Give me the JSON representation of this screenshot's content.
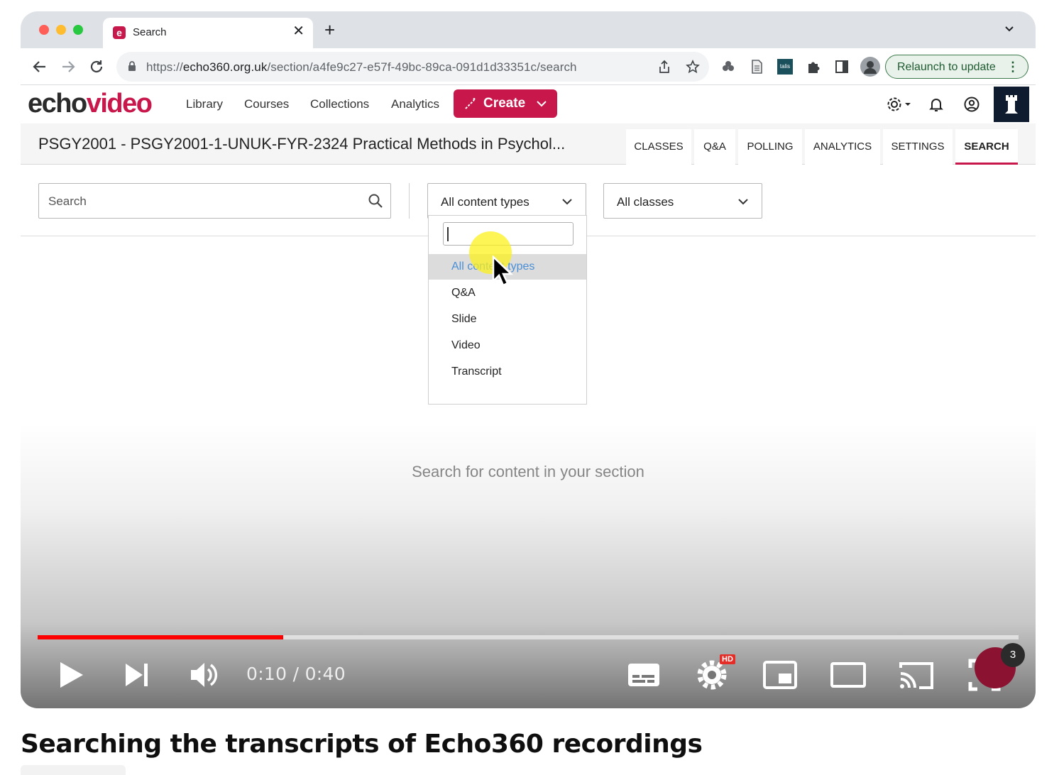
{
  "browser": {
    "tab_title": "Search",
    "url_scheme": "https://",
    "url_host": "echo360.org.uk",
    "url_path": "/section/a4fe9c27-e57f-49bc-89ca-091d1d33351c/search",
    "relaunch_label": "Relaunch to update",
    "ext_label": "talis"
  },
  "app": {
    "logo_echo": "echo",
    "logo_video": "video",
    "nav": [
      "Library",
      "Courses",
      "Collections",
      "Analytics"
    ],
    "create_label": "Create"
  },
  "course": {
    "title": "PSGY2001 - PSGY2001-1-UNUK-FYR-2324 Practical Methods in Psychol...",
    "tabs": [
      "CLASSES",
      "Q&A",
      "POLLING",
      "ANALYTICS",
      "SETTINGS",
      "SEARCH"
    ],
    "active_tab": "SEARCH"
  },
  "search": {
    "placeholder": "Search",
    "content_type_selected": "All content types",
    "class_selected": "All classes",
    "dropdown_options": [
      "All content types",
      "Q&A",
      "Slide",
      "Video",
      "Transcript"
    ],
    "dropdown_highlighted": "All content types",
    "empty_message": "Search for content in your section"
  },
  "player": {
    "time_current": "0:10",
    "time_separator": " / ",
    "time_total": "0:40",
    "progress_fraction": 0.25,
    "hd_label": "HD",
    "notification_count": "3",
    "video_title": "Searching the transcripts of Echo360 recordings"
  },
  "colors": {
    "echo_brand": "#c8174b",
    "progress_red": "#ff0000",
    "relaunch_green": "#1e5b30"
  },
  "icons": [
    "back-icon",
    "forward-icon",
    "reload-icon",
    "lock-icon",
    "share-icon",
    "star-icon",
    "puzzle-icon",
    "sidepanel-icon",
    "settings-gear-icon",
    "bell-icon",
    "account-icon",
    "search-icon",
    "chevron-down-icon",
    "play-icon",
    "next-icon",
    "volume-icon",
    "subtitles-icon",
    "miniplayer-icon",
    "theater-icon",
    "cast-icon",
    "fullscreen-icon"
  ]
}
